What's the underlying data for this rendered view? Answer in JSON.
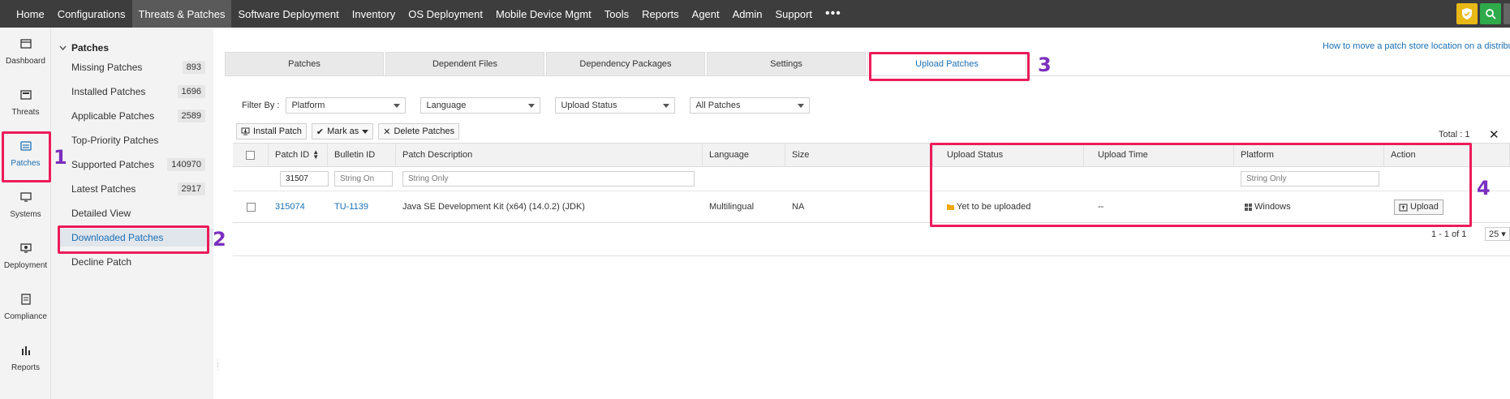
{
  "topnav": {
    "items": [
      "Home",
      "Configurations",
      "Threats & Patches",
      "Software Deployment",
      "Inventory",
      "OS Deployment",
      "Mobile Device Mgmt",
      "Tools",
      "Reports",
      "Agent",
      "Admin",
      "Support"
    ],
    "active": "Threats & Patches",
    "more": "•••"
  },
  "rail": {
    "items": [
      {
        "label": "Dashboard",
        "icon": "dashboard-icon"
      },
      {
        "label": "Threats",
        "icon": "threats-icon"
      },
      {
        "label": "Patches",
        "icon": "patches-icon"
      },
      {
        "label": "Systems",
        "icon": "systems-icon"
      },
      {
        "label": "Deployment",
        "icon": "deployment-icon"
      },
      {
        "label": "Compliance",
        "icon": "compliance-icon"
      },
      {
        "label": "Reports",
        "icon": "reports-icon"
      }
    ]
  },
  "subnav": {
    "heading": "Patches",
    "items": [
      {
        "label": "Missing Patches",
        "count": "893"
      },
      {
        "label": "Installed Patches",
        "count": "1696"
      },
      {
        "label": "Applicable Patches",
        "count": "2589"
      },
      {
        "label": "Top-Priority Patches",
        "count": ""
      },
      {
        "label": "Supported Patches",
        "count": "140970"
      },
      {
        "label": "Latest Patches",
        "count": "2917"
      },
      {
        "label": "Detailed View",
        "count": ""
      },
      {
        "label": "Downloaded Patches",
        "count": ""
      },
      {
        "label": "Decline Patch",
        "count": ""
      }
    ]
  },
  "tabs": [
    "Patches",
    "Dependent Files",
    "Dependency Packages",
    "Settings",
    "Upload Patches"
  ],
  "help_link": "How to move a patch store location on a distribut",
  "filters": {
    "label": "Filter By :",
    "platform": "Platform",
    "language": "Language",
    "upload_status": "Upload Status",
    "all_patches": "All Patches"
  },
  "actions": {
    "install": "Install Patch",
    "mark_as": "Mark as",
    "delete": "Delete Patches"
  },
  "total": "Total : 1",
  "table": {
    "headers": {
      "patch_id": "Patch ID",
      "bulletin_id": "Bulletin ID",
      "description": "Patch Description",
      "language": "Language",
      "size": "Size",
      "upload_status": "Upload Status",
      "upload_time": "Upload Time",
      "platform": "Platform",
      "action": "Action"
    },
    "filters": {
      "patch_id": "31507",
      "bulletin_id": "String On",
      "description": "String Only",
      "platform": "String Only"
    },
    "rows": [
      {
        "patch_id": "315074",
        "bulletin_id": "TU-1139",
        "description": "Java SE Development Kit (x64) (14.0.2) (JDK)",
        "language": "Multilingual",
        "size": "NA",
        "upload_status": "Yet to be uploaded",
        "upload_time": "--",
        "platform": "Windows",
        "action": "Upload"
      }
    ]
  },
  "pager": {
    "range": "1 - 1 of 1",
    "page_size": "25"
  },
  "annotations": [
    "1",
    "2",
    "3",
    "4"
  ],
  "colors": {
    "topbar": "#3d3d3d",
    "accent": "#1a6fb5",
    "highlight": "#ec1c5b",
    "annotation": "#7b2fbe"
  }
}
